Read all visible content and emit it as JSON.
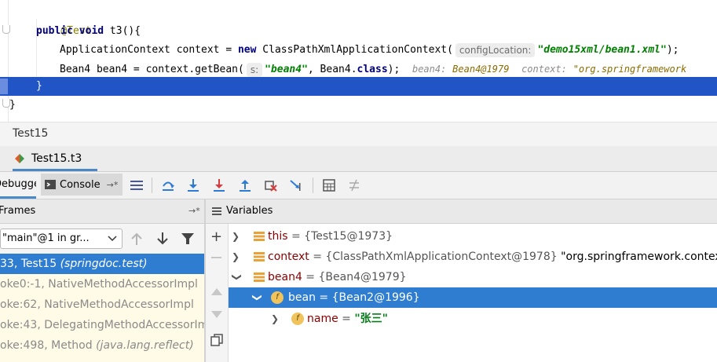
{
  "editor": {
    "line1": "@Test",
    "line2_kw": "public void",
    "line2_rest": " t3(){",
    "line3_type": "ApplicationContext context = ",
    "line3_new": "new",
    "line3_call": " ClassPathXmlApplicationContext(",
    "line3_hint": "configLocation:",
    "line3_str": "\"demo15xml/bean1.xml\"",
    "line3_end": ");",
    "line4_start": "Bean4 bean4 = context.getBean(",
    "line4_hint": "s:",
    "line4_str": "\"bean4\"",
    "line4_mid": ", Bean4.",
    "line4_kw": "class",
    "line4_end": ");",
    "line4_inl1_name": "bean4:",
    "line4_inl1_val": "Bean4@1979",
    "line4_inl2_name": "context:",
    "line4_inl2_val": "\"org.springframework",
    "line5": "}",
    "line6": "}"
  },
  "breadcrumb": {
    "text": "Test15"
  },
  "run_tab": {
    "label": "Test15.t3"
  },
  "toolbar": {
    "debugger_label": "Debugger",
    "console_label": "Console",
    "console_pin": "→*"
  },
  "frames": {
    "header": "Frames",
    "header_pin": "→*",
    "thread": "\"main\"@1 in gr...",
    "rows": [
      {
        "text": "33, Test15 ",
        "pkg": "(springdoc.test)"
      },
      {
        "text": "oke0:-1, NativeMethodAccessorImpl",
        "pkg": ""
      },
      {
        "text": "oke:62, NativeMethodAccessorImpl",
        "pkg": ""
      },
      {
        "text": "oke:43, DelegatingMethodAccessorImpl",
        "pkg": ""
      },
      {
        "text": "oke:498, Method ",
        "pkg": "(java.lang.reflect)"
      }
    ]
  },
  "variables": {
    "header": "Variables",
    "rows": [
      {
        "name": "this",
        "value": " = {Test15@1973}",
        "extra": ""
      },
      {
        "name": "context",
        "value": " = {ClassPathXmlApplicationContext@1978} ",
        "extra": "\"org.springframework.context.support"
      },
      {
        "name": "bean4",
        "value": " = {Bean4@1979}",
        "extra": ""
      },
      {
        "name": "bean",
        "value": " = {Bean2@1996}",
        "extra": ""
      },
      {
        "name": "name",
        "value": " = ",
        "extra": "\"张三\""
      }
    ]
  },
  "colors": {
    "accent": "#2f7dd1",
    "editor_highlight": "#2154c4",
    "frames_bg": "#fffbe6"
  }
}
